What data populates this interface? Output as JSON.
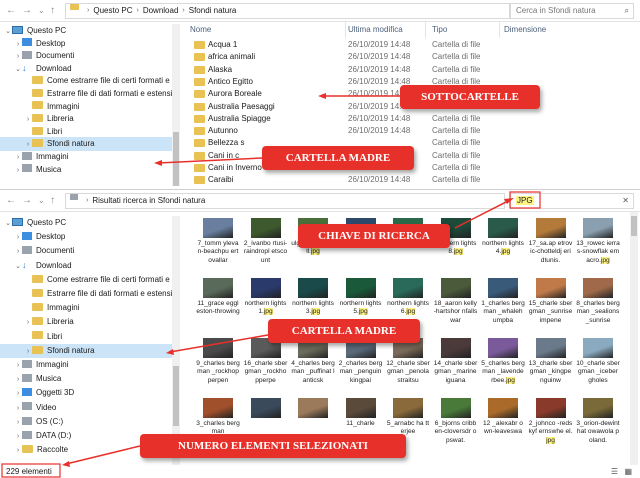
{
  "top": {
    "nav": {
      "back": "←",
      "fwd": "→",
      "down": "⌄",
      "up": "↑"
    },
    "breadcrumb": [
      "Questo PC",
      "Download",
      "Sfondi natura"
    ],
    "search_placeholder": "Cerca in Sfondi natura",
    "columns": {
      "name": "Nome",
      "date": "Ultima modifica",
      "type": "Tipo",
      "size": "Dimensione"
    },
    "tree": [
      {
        "label": "Questo PC",
        "arrow": "⌄",
        "icon": "pc"
      },
      {
        "label": "Desktop",
        "arrow": "›",
        "icon": "blue"
      },
      {
        "label": "Documenti",
        "arrow": "›",
        "icon": "grey"
      },
      {
        "label": "Download",
        "arrow": "⌄",
        "icon": "download"
      },
      {
        "label": "Come estrarre file di certi formati e estensi",
        "arrow": "",
        "icon": "folder"
      },
      {
        "label": "Estrarre file di dati formati e estensioni da c",
        "arrow": "",
        "icon": "folder"
      },
      {
        "label": "Immagini",
        "arrow": "",
        "icon": "folder"
      },
      {
        "label": "Libreria",
        "arrow": "›",
        "icon": "folder"
      },
      {
        "label": "Libri",
        "arrow": "",
        "icon": "folder"
      },
      {
        "label": "Sfondi natura",
        "arrow": "›",
        "icon": "folder",
        "selected": true
      },
      {
        "label": "Immagini",
        "arrow": "›",
        "icon": "grey"
      },
      {
        "label": "Musica",
        "arrow": "›",
        "icon": "grey"
      }
    ],
    "files": [
      {
        "name": "Acqua 1",
        "date": "26/10/2019 14:48",
        "type": "Cartella di file"
      },
      {
        "name": "africa animali",
        "date": "26/10/2019 14:48",
        "type": "Cartella di file"
      },
      {
        "name": "Alaska",
        "date": "26/10/2019 14:48",
        "type": "Cartella di file"
      },
      {
        "name": "Antico Egitto",
        "date": "26/10/2019 14:48",
        "type": "Cartella di file"
      },
      {
        "name": "Aurora Boreale",
        "date": "26/10/2019 14:48",
        "type": "Cartella di file"
      },
      {
        "name": "Australia Paesaggi",
        "date": "26/10/2019 14:48",
        "type": "Cartella di file"
      },
      {
        "name": "Australia Spiagge",
        "date": "26/10/2019 14:48",
        "type": "Cartella di file"
      },
      {
        "name": "Autunno",
        "date": "26/10/2019 14:48",
        "type": "Cartella di file"
      },
      {
        "name": "Bellezza s",
        "date": "",
        "type": "Cartella di file"
      },
      {
        "name": "Cani in c",
        "date": "",
        "type": "Cartella di file"
      },
      {
        "name": "Cani in Inverno",
        "date": "26/10/2019 14:48",
        "type": "Cartella di file"
      },
      {
        "name": "Caraibi",
        "date": "26/10/2019 14:48",
        "type": "Cartella di file"
      }
    ]
  },
  "bottom": {
    "breadcrumb": [
      "Risultati ricerca in Sfondi natura"
    ],
    "search_value": "JPG",
    "status": "229 elementi",
    "tree": [
      {
        "label": "Questo PC",
        "arrow": "⌄",
        "icon": "pc"
      },
      {
        "label": "Desktop",
        "arrow": "›",
        "icon": "blue"
      },
      {
        "label": "Documenti",
        "arrow": "›",
        "icon": "grey"
      },
      {
        "label": "Download",
        "arrow": "⌄",
        "icon": "download"
      },
      {
        "label": "Come estrarre file di certi formati e estensi",
        "arrow": "",
        "icon": "folder"
      },
      {
        "label": "Estrarre file di dati formati e estensioni da d",
        "arrow": "",
        "icon": "folder"
      },
      {
        "label": "Immagini",
        "arrow": "",
        "icon": "folder"
      },
      {
        "label": "Libreria",
        "arrow": "›",
        "icon": "folder"
      },
      {
        "label": "Libri",
        "arrow": "",
        "icon": "folder"
      },
      {
        "label": "Sfondi natura",
        "arrow": "›",
        "icon": "folder",
        "selected": true
      },
      {
        "label": "Immagini",
        "arrow": "›",
        "icon": "grey"
      },
      {
        "label": "Musica",
        "arrow": "›",
        "icon": "grey"
      },
      {
        "label": "Oggetti 3D",
        "arrow": "›",
        "icon": "blue"
      },
      {
        "label": "Video",
        "arrow": "›",
        "icon": "grey"
      },
      {
        "label": "OS (C:)",
        "arrow": "›",
        "icon": "grey"
      },
      {
        "label": "DATA (D:)",
        "arrow": "›",
        "icon": "grey"
      },
      {
        "label": "Raccolte",
        "arrow": "›",
        "icon": "folder"
      }
    ],
    "thumbs": [
      {
        "pre": "7_tomm ylevan-beachpu ertovallar",
        "hl": "",
        "post": "",
        "color": "#6a7fa0"
      },
      {
        "pre": "2_ivanbo rtusi-raindropl etscount",
        "hl": "",
        "post": "",
        "color": "#3d5a2e"
      },
      {
        "pre": "ulgaria-waterfall.",
        "hl": "jpg",
        "post": "",
        "color": "#4a6e3a"
      },
      {
        "pre": "",
        "hl": "",
        "post": "",
        "color": "#2e4a6a"
      },
      {
        "pre": "",
        "hl": "",
        "post": "",
        "color": "#2a6a4a"
      },
      {
        "pre": "northern lights8.",
        "hl": "jpg",
        "post": "",
        "color": "#1e4a3a"
      },
      {
        "pre": "northern lights4.",
        "hl": "jpg",
        "post": "",
        "color": "#2a5a4a"
      },
      {
        "pre": "17_sa.ap etrovic-chotteldj eridtunis.",
        "hl": "",
        "post": "",
        "color": "#b37a3a"
      },
      {
        "pre": "13_rowec ierras-snowflak emacro.",
        "hl": "jpg",
        "post": "",
        "color": "#8aa0b0"
      },
      {
        "pre": "11_grace eggleston-throwing",
        "hl": "",
        "post": "",
        "color": "#5a6a5a"
      },
      {
        "pre": "northern lights1.",
        "hl": "jpg",
        "post": "",
        "color": "#2a3a6a"
      },
      {
        "pre": "northern lights3.",
        "hl": "jpg",
        "post": "",
        "color": "#1a4a4a"
      },
      {
        "pre": "northern lights5.",
        "hl": "jpg",
        "post": "",
        "color": "#1a5a3a"
      },
      {
        "pre": "northern lights6.",
        "hl": "jpg",
        "post": "",
        "color": "#2a6a5a"
      },
      {
        "pre": "18_aaron kelly-hartshor nfallswar",
        "hl": "",
        "post": "",
        "color": "#4a5a3a"
      },
      {
        "pre": "1_charles bergman _whaleh umpba",
        "hl": "",
        "post": "",
        "color": "#3a5a7a"
      },
      {
        "pre": "15_charle sbergman _sunrise impene",
        "hl": "",
        "post": "",
        "color": "#c07a4a"
      },
      {
        "pre": "8_charles bergman _sealions _sunrise",
        "hl": "",
        "post": "",
        "color": "#a06a4a"
      },
      {
        "pre": "9_charles bergman _rockhop perpen",
        "hl": "",
        "post": "",
        "color": "#4a4a4a"
      },
      {
        "pre": "16_charle sbergman _rockho pperpe",
        "hl": "",
        "post": "",
        "color": "#5a5a5a"
      },
      {
        "pre": "4_charles bergman _puffinat lanticsk",
        "hl": "",
        "post": "",
        "color": "#6a6a5a"
      },
      {
        "pre": "2_charles bergman _penguin kingpai",
        "hl": "",
        "post": "",
        "color": "#5a6a7a"
      },
      {
        "pre": "12_charle sbergman _penola straitsu",
        "hl": "",
        "post": "",
        "color": "#7a6a5a"
      },
      {
        "pre": "14_charle sbergman _marine iguana",
        "hl": "",
        "post": "",
        "color": "#4a3a3a"
      },
      {
        "pre": "5_charles bergman _lavende rbee.",
        "hl": "jpg",
        "post": "",
        "color": "#7a5a9a"
      },
      {
        "pre": "13_charle sbergman _kingpe nguinw",
        "hl": "",
        "post": "",
        "color": "#6a7a8a"
      },
      {
        "pre": "10_charle sbergman _iceber gholes",
        "hl": "",
        "post": "",
        "color": "#8aaac0"
      },
      {
        "pre": "3_charles bergman",
        "hl": "",
        "post": "",
        "color": "#a0502a"
      },
      {
        "pre": "",
        "hl": "",
        "post": "",
        "color": "#3a4a5a"
      },
      {
        "pre": "",
        "hl": "",
        "post": "",
        "color": "#9a7a5a"
      },
      {
        "pre": "11_charle",
        "hl": "",
        "post": "",
        "color": "#5a4a3a"
      },
      {
        "pre": "5_arnabc ha tterjee",
        "hl": "",
        "post": "",
        "color": "#8a6a3a"
      },
      {
        "pre": "6_bjorns cribben-cloversdr opswat.",
        "hl": "",
        "post": "",
        "color": "#4a7a3a"
      },
      {
        "pre": "12 _alexabr own-leaveswa",
        "hl": "",
        "post": "",
        "color": "#aa6a2a"
      },
      {
        "pre": "2_johnco -redskyf ernswhe el.",
        "hl": "jpg",
        "post": "",
        "color": "#8a3a2a"
      },
      {
        "pre": "3_orion-dewinthat owawola poland.",
        "hl": "",
        "post": "",
        "color": "#7a6a3a"
      }
    ]
  },
  "callouts": {
    "sottocartelle": "SOTTOCARTELLE",
    "cartella_madre_1": "CARTELLA MADRE",
    "chiave": "CHIAVE DI RICERCA",
    "cartella_madre_2": "CARTELLA MADRE",
    "numero": "NUMERO ELEMENTI SELEZIONATI"
  }
}
